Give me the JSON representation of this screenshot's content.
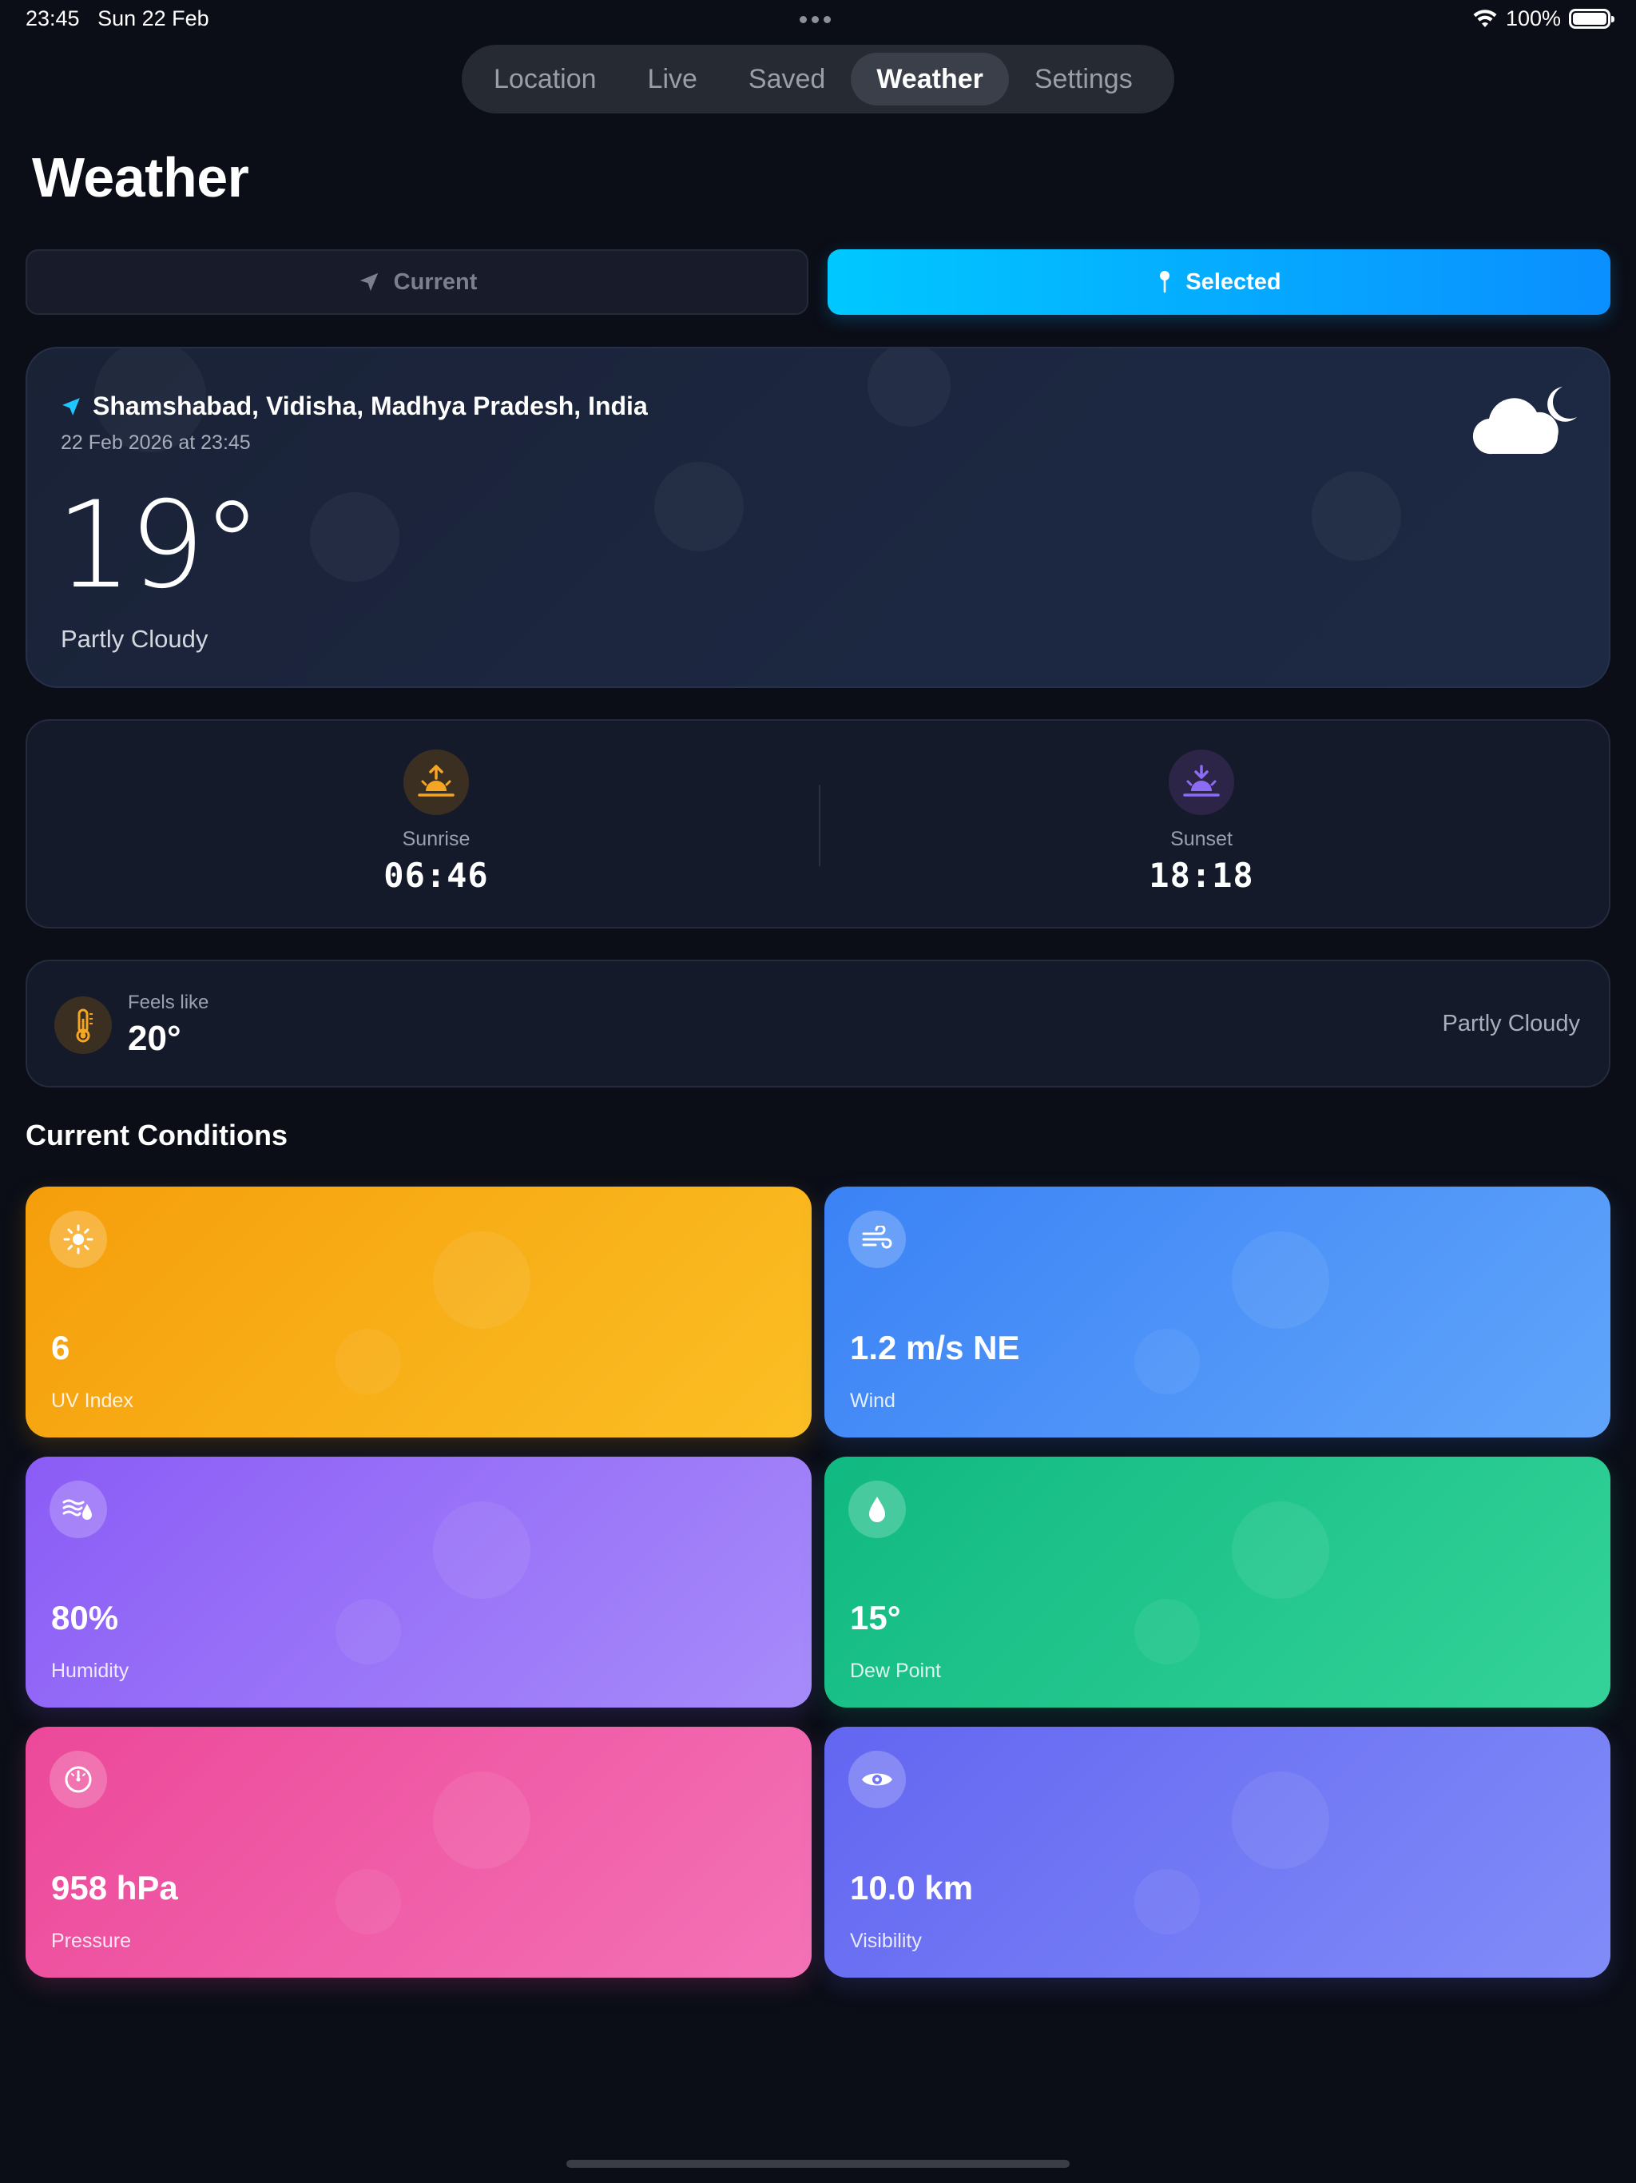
{
  "status_bar": {
    "time": "23:45",
    "date": "Sun 22 Feb",
    "battery": "100%"
  },
  "nav": {
    "tabs": [
      {
        "label": "Location"
      },
      {
        "label": "Live"
      },
      {
        "label": "Saved"
      },
      {
        "label": "Weather",
        "active": true
      },
      {
        "label": "Settings"
      }
    ]
  },
  "page": {
    "title": "Weather"
  },
  "mode_toggle": {
    "current_label": "Current",
    "selected_label": "Selected",
    "active": "Selected"
  },
  "weather_card": {
    "location": "Shamshabad, Vidisha, Madhya Pradesh, India",
    "datetime": "22 Feb 2026 at 23:45",
    "temperature": "19°",
    "condition": "Partly Cloudy",
    "icon": "cloud-moon-icon"
  },
  "sun": {
    "sunrise_label": "Sunrise",
    "sunrise_time": "06:46",
    "sunset_label": "Sunset",
    "sunset_time": "18:18"
  },
  "feels_like": {
    "label": "Feels like",
    "value": "20°",
    "condition": "Partly Cloudy"
  },
  "conditions": {
    "title": "Current Conditions",
    "uv": {
      "value": "6",
      "label": "UV Index",
      "icon": "sun-icon"
    },
    "wind": {
      "value": "1.2 m/s NE",
      "label": "Wind",
      "icon": "wind-icon"
    },
    "humidity": {
      "value": "80%",
      "label": "Humidity",
      "icon": "humidity-icon"
    },
    "dew_point": {
      "value": "15°",
      "label": "Dew Point",
      "icon": "droplet-icon"
    },
    "pressure": {
      "value": "958 hPa",
      "label": "Pressure",
      "icon": "gauge-icon"
    },
    "visibility": {
      "value": "10.0 km",
      "label": "Visibility",
      "icon": "eye-icon"
    }
  },
  "colors": {
    "background": "#0b0e17",
    "accent": "#00c8ff",
    "uv": "#f59e0b",
    "wind": "#3b82f6",
    "humidity": "#8b5cf6",
    "dew_point": "#10b981",
    "pressure": "#ec4899",
    "visibility": "#6366f1"
  }
}
